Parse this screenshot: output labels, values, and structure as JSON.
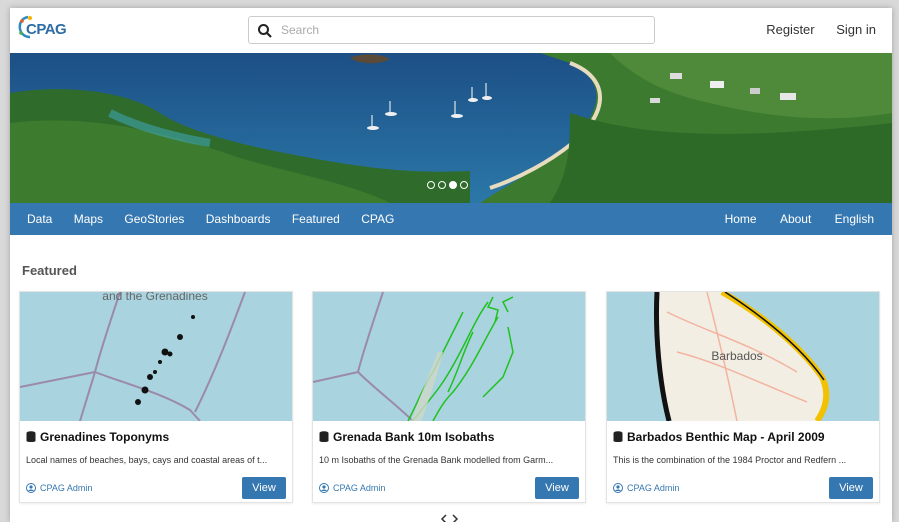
{
  "brand": {
    "name": "CPAG"
  },
  "search": {
    "placeholder": "Search"
  },
  "auth": {
    "register": "Register",
    "sign_in": "Sign in"
  },
  "nav": {
    "left": [
      "Data",
      "Maps",
      "GeoStories",
      "Dashboards",
      "Featured",
      "CPAG"
    ],
    "right": [
      "Home",
      "About",
      "English"
    ]
  },
  "carousel": {
    "slides": 4,
    "active_index": 2
  },
  "featured": {
    "heading": "Featured",
    "cards": [
      {
        "title": "Grenadines Toponyms",
        "description": "Local names of beaches, bays, cays and coastal areas of t...",
        "owner": "CPAG Admin",
        "view_label": "View",
        "map_label": "and the Grenadines"
      },
      {
        "title": "Grenada Bank 10m Isobaths",
        "description": "10 m Isobaths of the Grenada Bank modelled from Garm...",
        "owner": "CPAG Admin",
        "view_label": "View"
      },
      {
        "title": "Barbados Benthic Map - April 2009",
        "description": "This is the combination of the 1984 Proctor and Redfern ...",
        "owner": "CPAG Admin",
        "view_label": "View",
        "map_label": "Barbados"
      }
    ]
  },
  "colors": {
    "accent": "#3577b0",
    "sea": "#a9d3df",
    "forest": "#2f6b2a"
  }
}
